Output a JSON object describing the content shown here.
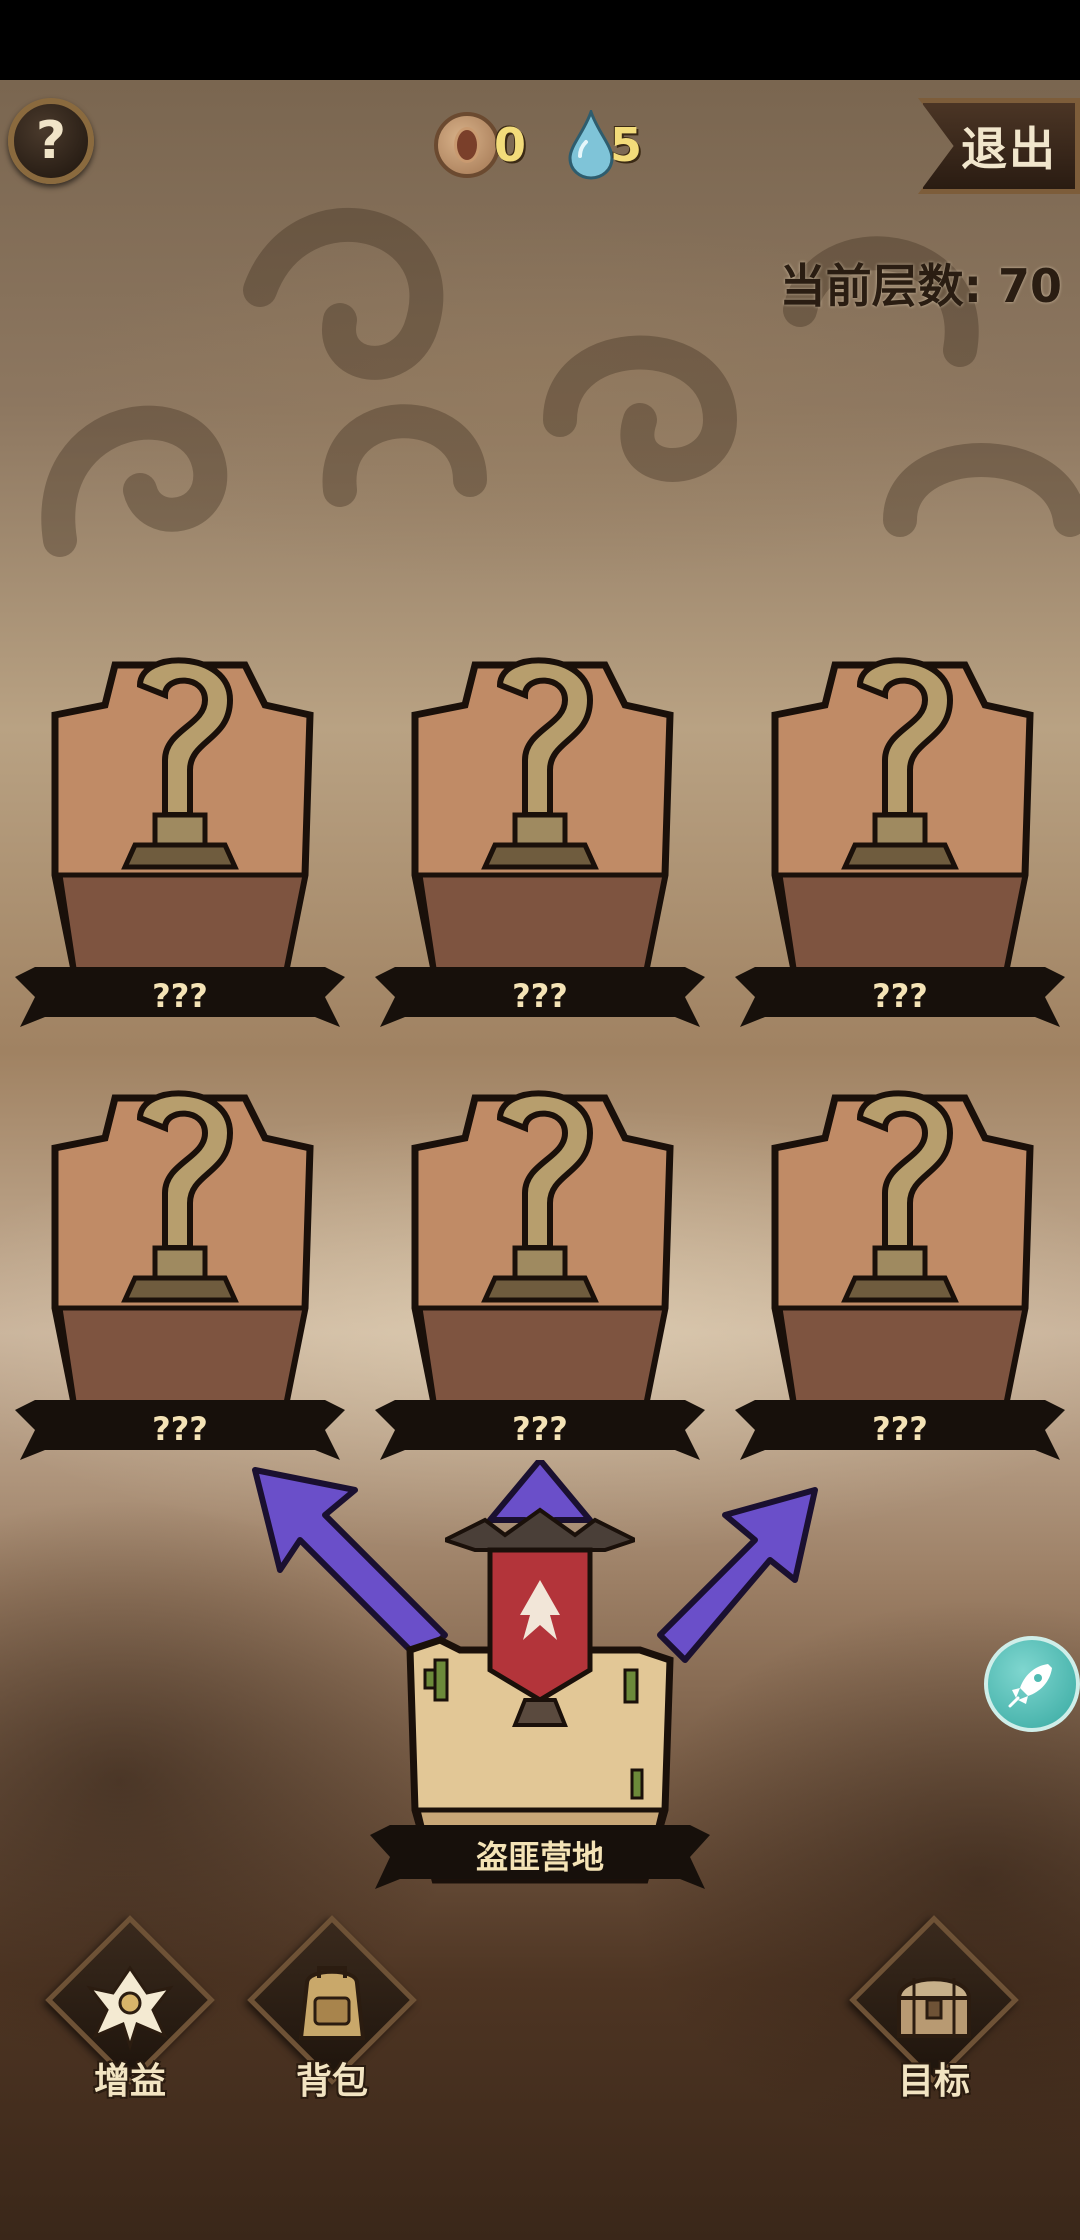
{
  "header": {
    "help_icon": "?",
    "coin_count": "0",
    "water_count": "5",
    "exit_label": "退出",
    "floor_label": "当前层数: 70"
  },
  "nodes": [
    {
      "label": "???"
    },
    {
      "label": "???"
    },
    {
      "label": "???"
    },
    {
      "label": "???"
    },
    {
      "label": "???"
    },
    {
      "label": "???"
    }
  ],
  "current_node": {
    "label": "盗匪营地"
  },
  "dock": {
    "buff_label": "增益",
    "bag_label": "背包",
    "goal_label": "目标"
  },
  "icons": {
    "help": "question-icon",
    "coin": "coin-icon",
    "water": "water-drop-icon",
    "rocket": "rocket-icon",
    "buff": "buff-emblem-icon",
    "bag": "backpack-icon",
    "goal": "treasure-chest-icon"
  },
  "colors": {
    "path_arrow": "#6a4fc9",
    "label_gold": "#f4e3b6",
    "currency_gold": "#f3dc7a",
    "rocket_teal": "#4fbcb3"
  }
}
